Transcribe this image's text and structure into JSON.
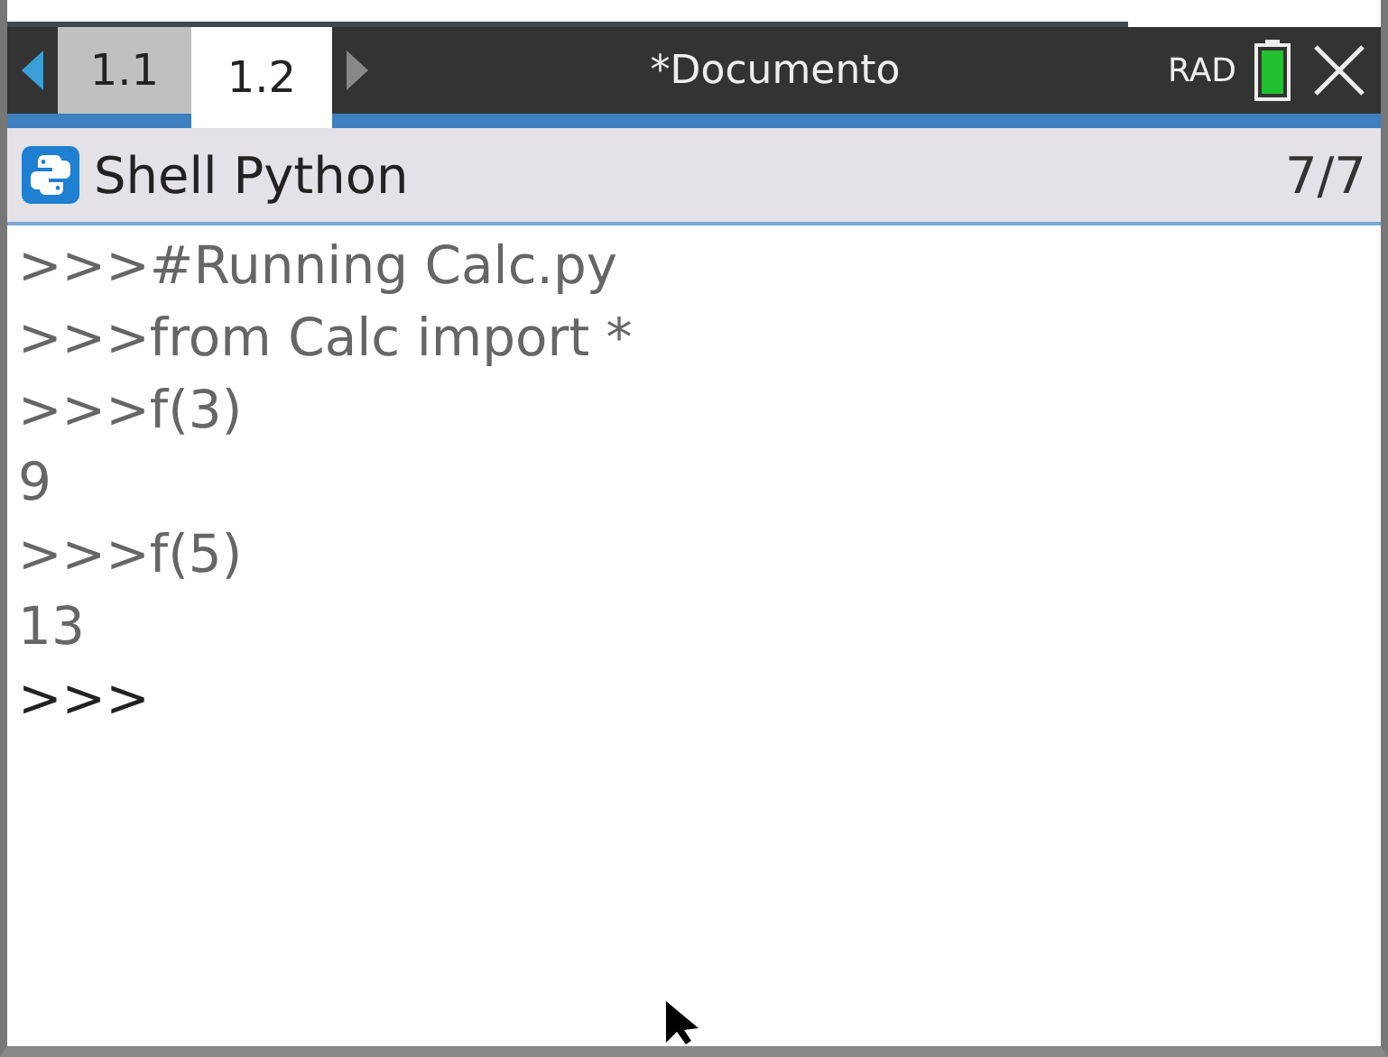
{
  "tab_bar": {
    "back_enabled": true,
    "forward_enabled": false,
    "tabs": [
      {
        "label": "1.1",
        "selected": false
      },
      {
        "label": "1.2",
        "selected": true
      }
    ],
    "document_title": "*Documento",
    "angle_mode": "RAD"
  },
  "header": {
    "title": "Shell Python",
    "page_count": "7/7"
  },
  "shell": {
    "lines": [
      {
        "kind": "history",
        "text": ">>>#Running Calc.py"
      },
      {
        "kind": "history",
        "text": ">>>from Calc import *"
      },
      {
        "kind": "history",
        "text": ">>>f(3)"
      },
      {
        "kind": "history",
        "text": "9"
      },
      {
        "kind": "history",
        "text": ">>>f(5)"
      },
      {
        "kind": "history",
        "text": "13"
      },
      {
        "kind": "prompt",
        "text": ">>>"
      }
    ]
  }
}
